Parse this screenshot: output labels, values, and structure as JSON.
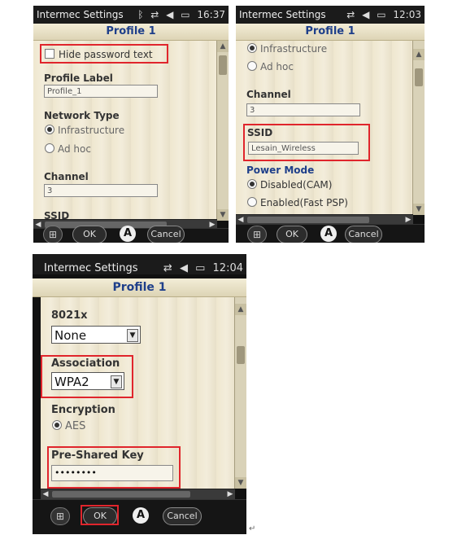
{
  "shot1": {
    "status": {
      "title": "Intermec Settings",
      "time": "16:37",
      "icons": [
        "bluetooth-icon",
        "sync-icon",
        "speaker-icon",
        "battery-icon"
      ]
    },
    "header": "Profile 1",
    "hide_password": "Hide password text",
    "profile_label": {
      "label": "Profile Label",
      "value": "Profile_1"
    },
    "network_type": {
      "label": "Network Type",
      "options": [
        "Infrastructure",
        "Ad hoc"
      ],
      "selected": 0
    },
    "channel": {
      "label": "Channel",
      "value": "3"
    },
    "ssid_label": "SSID",
    "softkeys": {
      "ok": "OK",
      "input": "A",
      "cancel": "Cancel"
    }
  },
  "shot2": {
    "status": {
      "title": "Intermec Settings",
      "time": "12:03"
    },
    "header": "Profile 1",
    "network_options": [
      "Infrastructure",
      "Ad hoc"
    ],
    "channel": {
      "label": "Channel",
      "value": "3"
    },
    "ssid": {
      "label": "SSID",
      "value": "Lesain_Wireless"
    },
    "power_mode": {
      "label": "Power Mode",
      "options": [
        "Disabled(CAM)",
        "Enabled(Fast PSP)"
      ],
      "selected": 0
    },
    "softkeys": {
      "ok": "OK",
      "input": "A",
      "cancel": "Cancel"
    }
  },
  "shot3": {
    "status": {
      "title": "Intermec Settings",
      "time": "12:04"
    },
    "header": "Profile 1",
    "dot1x": {
      "label": "8021x",
      "value": "None"
    },
    "association": {
      "label": "Association",
      "value": "WPA2"
    },
    "encryption": {
      "label": "Encryption",
      "option": "AES"
    },
    "psk": {
      "label": "Pre-Shared Key",
      "value": "••••••••"
    },
    "softkeys": {
      "ok": "OK",
      "input": "A",
      "cancel": "Cancel"
    }
  },
  "colors": {
    "highlight": "#e0252c",
    "header_text": "#1e3f8a",
    "form_bg": "#efe7cf"
  }
}
